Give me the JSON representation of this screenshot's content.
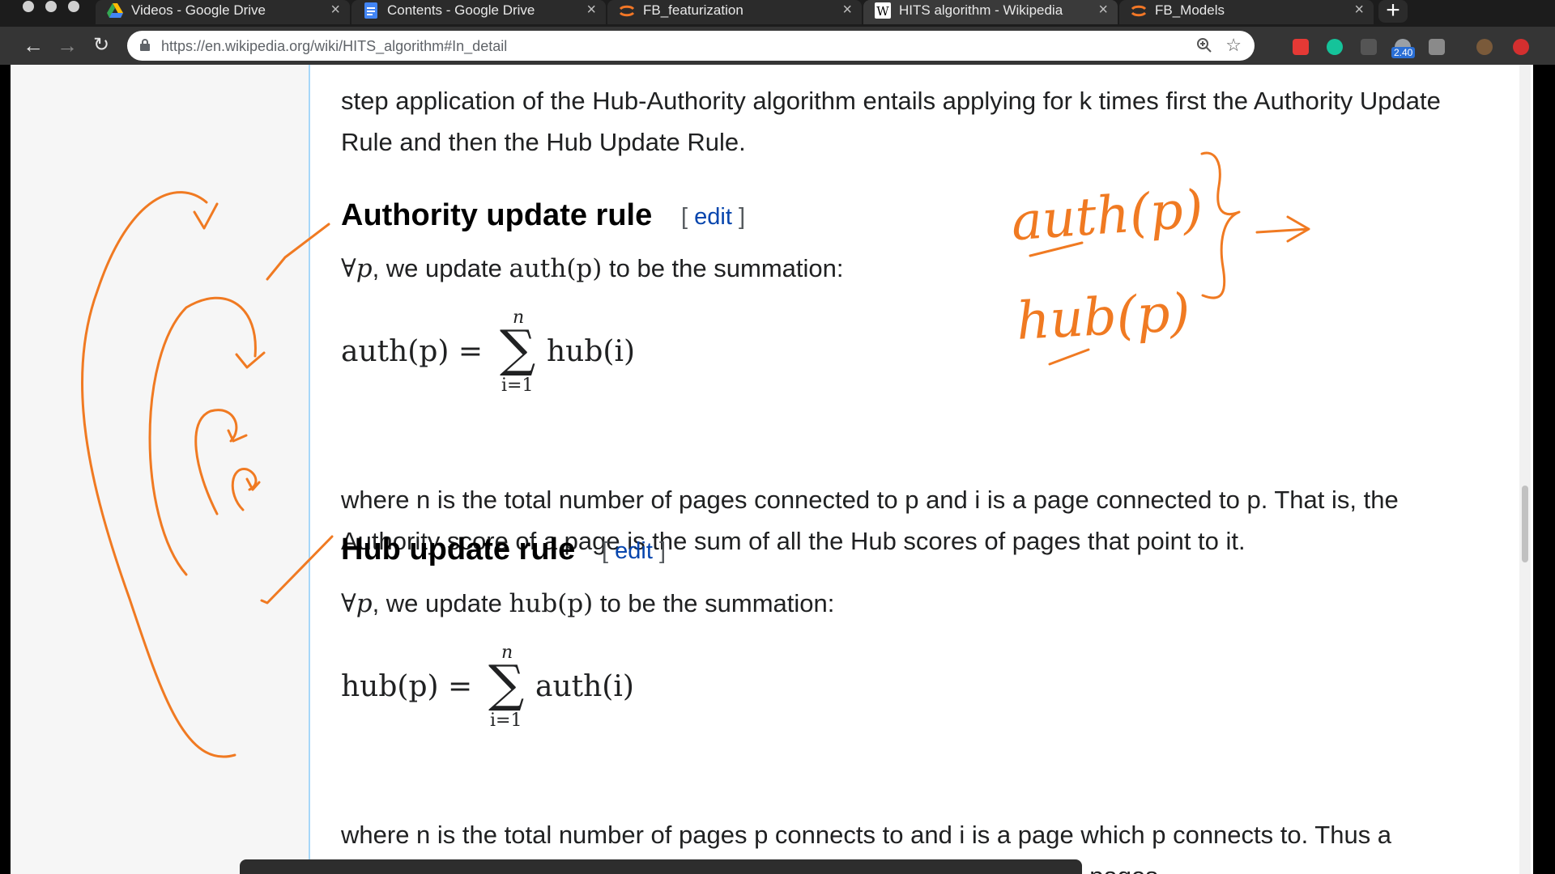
{
  "tabs": [
    {
      "label": "Videos - Google Drive",
      "icon": "google-drive-icon"
    },
    {
      "label": "Contents - Google Drive",
      "icon": "google-docs-icon"
    },
    {
      "label": "FB_featurization",
      "icon": "jupyter-icon"
    },
    {
      "label": "HITS algorithm - Wikipedia",
      "icon": "wikipedia-icon",
      "active": true
    },
    {
      "label": "FB_Models",
      "icon": "jupyter-icon"
    }
  ],
  "toolbar": {
    "url": "https://en.wikipedia.org/wiki/HITS_algorithm#In_detail",
    "extension_badge": "2.40"
  },
  "article": {
    "intro_lines": [
      "step application of the Hub-Authority algorithm entails applying for k times first the Authority Update",
      "Rule and then the Hub Update Rule."
    ],
    "authority": {
      "heading": "Authority update rule",
      "edit_open": "[",
      "edit_label": "edit",
      "edit_close": "]",
      "forall": "∀p",
      "intro_a": ", we update ",
      "intro_fn": "auth(p)",
      "intro_b": " to be the summation:",
      "formula_lhs": "auth(p) =",
      "formula_upper": "n",
      "formula_sigma": "∑",
      "formula_lower": "i=1",
      "formula_rhs": "hub(i)",
      "desc_lines": [
        "where n is the total number of pages connected to p and i is a page connected to p. That is, the",
        "Authority score of a page is the sum of all the Hub scores of pages that point to it."
      ]
    },
    "hub": {
      "heading": "Hub update rule",
      "edit_open": "[",
      "edit_label": "edit",
      "edit_close": "]",
      "forall": "∀p",
      "intro_a": ", we update ",
      "intro_fn": "hub(p)",
      "intro_b": " to be the summation:",
      "formula_lhs": "hub(p) =",
      "formula_upper": "n",
      "formula_sigma": "∑",
      "formula_lower": "i=1",
      "formula_rhs": "auth(i)",
      "desc_lines": [
        "where n is the total number of pages p connects to and i is a page which p connects to. Thus a",
        "page's Hub score is the sum of the Authority scores of all its linking pages"
      ]
    }
  },
  "handwriting": {
    "auth": "auth(p)",
    "hub": "hub(p)",
    "color": "#f07a22"
  },
  "colors": {
    "link": "#0645ad",
    "sidebar_border": "#a7d7f9",
    "annotation": "#f07a22"
  }
}
